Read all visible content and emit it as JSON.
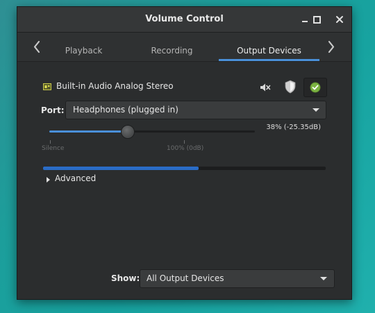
{
  "window": {
    "title": "Volume Control"
  },
  "tabs": [
    {
      "label": "Playback"
    },
    {
      "label": "Recording"
    },
    {
      "label": "Output Devices",
      "selected": true
    }
  ],
  "device": {
    "name": "Built-in Audio Analog Stereo",
    "icons": [
      "sound-card-icon",
      "mute-speaker-icon",
      "lock-channels-shield-icon",
      "set-default-check-icon"
    ],
    "port_label": "Port:",
    "port_value": "Headphones (plugged in)",
    "volume_fraction": 0.38,
    "volume_readout": "38% (-25.35dB)",
    "scale_marks": [
      "Silence",
      "100% (0dB)"
    ],
    "peak_level_fraction": 0.55,
    "advanced_label": "Advanced"
  },
  "footer": {
    "show_label": "Show:",
    "show_value": "All Output Devices"
  },
  "colors": {
    "accent": "#4a90d9",
    "window_bg": "#2b2d2e",
    "desktop_teal": "#1c9e9b",
    "check_green": "#8bc34a"
  }
}
